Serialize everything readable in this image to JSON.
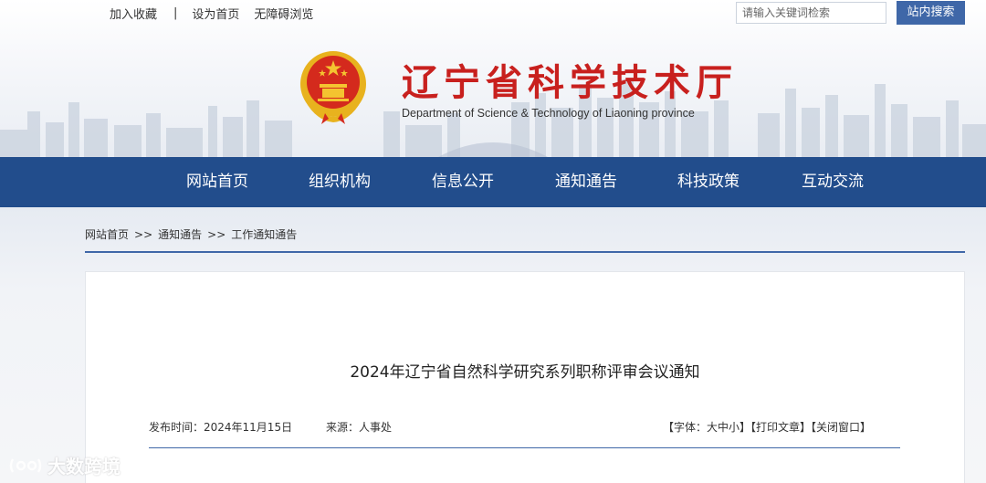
{
  "top_links": {
    "favorite": "加入收藏",
    "separator": "|",
    "homepage": "设为首页",
    "accessible": "无障碍浏览"
  },
  "search": {
    "placeholder": "请输入关键词检索",
    "button": "站内搜索"
  },
  "site": {
    "title": "辽宁省科学技术厅",
    "subtitle": "Department of Science & Technology of Liaoning province"
  },
  "nav": {
    "items": [
      "网站首页",
      "组织机构",
      "信息公开",
      "通知通告",
      "科技政策",
      "互动交流"
    ]
  },
  "breadcrumb": {
    "home": "网站首页",
    "arrow": ">>",
    "level1": "通知通告",
    "level2": "工作通知通告"
  },
  "article": {
    "title": "2024年辽宁省自然科学研究系列职称评审会议通知",
    "publish_time": "发布时间：2024年11月15日",
    "source": "来源：人事处",
    "font_size": "【字体：大中小】",
    "print": "【打印文章】",
    "close": "【关闭窗口】"
  },
  "watermark": {
    "text": "大数跨境"
  },
  "colors": {
    "nav_bg": "#224d8c",
    "title_red": "#c8201e",
    "accent_blue": "#3f67a8"
  }
}
